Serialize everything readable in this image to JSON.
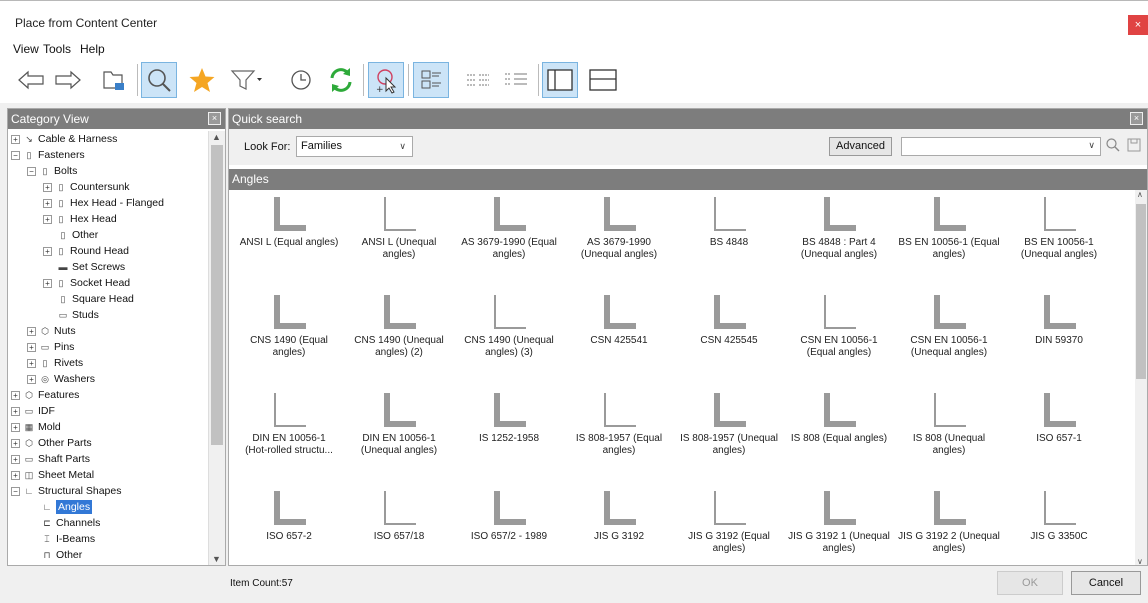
{
  "window": {
    "title": "Place from Content Center",
    "close_glyph": "×"
  },
  "menu": [
    "View",
    "Tools",
    "Help"
  ],
  "toolbar": [
    {
      "name": "back-arrow-icon",
      "selected": false
    },
    {
      "name": "forward-arrow-icon",
      "selected": false
    },
    {
      "name": "tree-view-icon",
      "selected": false
    },
    {
      "name": "search-icon",
      "selected": true
    },
    {
      "name": "favorites-star-icon",
      "selected": false
    },
    {
      "name": "filter-icon",
      "selected": false
    },
    {
      "name": "history-clock-icon",
      "selected": false
    },
    {
      "name": "refresh-icon",
      "selected": false
    },
    {
      "name": "autodrop-icon",
      "selected": true
    },
    {
      "name": "view-large-icons-icon",
      "selected": true
    },
    {
      "name": "view-list-icon",
      "selected": false
    },
    {
      "name": "view-details-icon",
      "selected": false
    },
    {
      "name": "layout-vertical-split-icon",
      "selected": true
    },
    {
      "name": "layout-horizontal-split-icon",
      "selected": false
    }
  ],
  "category_view": {
    "title": "Category View",
    "close_glyph": "×",
    "tree": [
      {
        "label": "Cable & Harness",
        "depth": 0,
        "expander": "+",
        "icon": "cable-icon"
      },
      {
        "label": "Fasteners",
        "depth": 0,
        "expander": "-",
        "icon": "fastener-icon"
      },
      {
        "label": "Bolts",
        "depth": 1,
        "expander": "-",
        "icon": "bolt-icon"
      },
      {
        "label": "Countersunk",
        "depth": 2,
        "expander": "+",
        "icon": "bolt-icon"
      },
      {
        "label": "Hex Head - Flanged",
        "depth": 2,
        "expander": "+",
        "icon": "bolt-icon"
      },
      {
        "label": "Hex Head",
        "depth": 2,
        "expander": "+",
        "icon": "bolt-icon"
      },
      {
        "label": "Other",
        "depth": 2,
        "expander": "",
        "icon": "bolt-icon"
      },
      {
        "label": "Round Head",
        "depth": 2,
        "expander": "+",
        "icon": "bolt-icon"
      },
      {
        "label": "Set Screws",
        "depth": 2,
        "expander": "",
        "icon": "screw-icon"
      },
      {
        "label": "Socket Head",
        "depth": 2,
        "expander": "+",
        "icon": "bolt-icon"
      },
      {
        "label": "Square Head",
        "depth": 2,
        "expander": "",
        "icon": "bolt-icon"
      },
      {
        "label": "Studs",
        "depth": 2,
        "expander": "",
        "icon": "stud-icon"
      },
      {
        "label": "Nuts",
        "depth": 1,
        "expander": "+",
        "icon": "nut-icon"
      },
      {
        "label": "Pins",
        "depth": 1,
        "expander": "+",
        "icon": "pin-icon"
      },
      {
        "label": "Rivets",
        "depth": 1,
        "expander": "+",
        "icon": "rivet-icon"
      },
      {
        "label": "Washers",
        "depth": 1,
        "expander": "+",
        "icon": "washer-icon"
      },
      {
        "label": "Features",
        "depth": 0,
        "expander": "+",
        "icon": "feature-icon"
      },
      {
        "label": "IDF",
        "depth": 0,
        "expander": "+",
        "icon": "idf-icon"
      },
      {
        "label": "Mold",
        "depth": 0,
        "expander": "+",
        "icon": "mold-icon"
      },
      {
        "label": "Other Parts",
        "depth": 0,
        "expander": "+",
        "icon": "part-icon"
      },
      {
        "label": "Shaft Parts",
        "depth": 0,
        "expander": "+",
        "icon": "shaft-icon"
      },
      {
        "label": "Sheet Metal",
        "depth": 0,
        "expander": "+",
        "icon": "sheet-metal-icon"
      },
      {
        "label": "Structural Shapes",
        "depth": 0,
        "expander": "-",
        "icon": "angle-icon"
      },
      {
        "label": "Angles",
        "depth": 1,
        "expander": "",
        "icon": "angle-icon",
        "selected": true
      },
      {
        "label": "Channels",
        "depth": 1,
        "expander": "",
        "icon": "channel-icon"
      },
      {
        "label": "I-Beams",
        "depth": 1,
        "expander": "",
        "icon": "ibeam-icon"
      },
      {
        "label": "Other",
        "depth": 1,
        "expander": "",
        "icon": "shape-icon"
      }
    ]
  },
  "quick_search": {
    "title": "Quick search",
    "close_glyph": "×",
    "look_for_label": "Look For:",
    "look_for_value": "Families",
    "advanced_label": "Advanced",
    "search_value": ""
  },
  "category_title": "Angles",
  "items": [
    {
      "l1": "ANSI L (Equal angles)",
      "l2": ""
    },
    {
      "l1": "ANSI L (Unequal",
      "l2": "angles)"
    },
    {
      "l1": "AS 3679-1990 (Equal",
      "l2": "angles)"
    },
    {
      "l1": "AS 3679-1990",
      "l2": "(Unequal angles)"
    },
    {
      "l1": "BS 4848",
      "l2": ""
    },
    {
      "l1": "BS 4848 : Part 4",
      "l2": "(Unequal angles)"
    },
    {
      "l1": "BS EN 10056-1 (Equal",
      "l2": "angles)"
    },
    {
      "l1": "BS EN 10056-1",
      "l2": "(Unequal angles)"
    },
    {
      "l1": "CNS 1490 (Equal",
      "l2": "angles)"
    },
    {
      "l1": "CNS 1490 (Unequal",
      "l2": "angles) (2)"
    },
    {
      "l1": "CNS 1490 (Unequal",
      "l2": "angles) (3)"
    },
    {
      "l1": "CSN 425541",
      "l2": ""
    },
    {
      "l1": "CSN 425545",
      "l2": ""
    },
    {
      "l1": "CSN EN 10056-1",
      "l2": "(Equal angles)"
    },
    {
      "l1": "CSN EN 10056-1",
      "l2": "(Unequal angles)"
    },
    {
      "l1": "DIN 59370",
      "l2": ""
    },
    {
      "l1": "DIN EN 10056-1",
      "l2": "(Hot-rolled structu..."
    },
    {
      "l1": "DIN EN 10056-1",
      "l2": "(Unequal angles)"
    },
    {
      "l1": "IS 1252-1958",
      "l2": ""
    },
    {
      "l1": "IS 808-1957 (Equal",
      "l2": "angles)"
    },
    {
      "l1": "IS 808-1957 (Unequal",
      "l2": "angles)"
    },
    {
      "l1": "IS 808 (Equal angles)",
      "l2": ""
    },
    {
      "l1": "IS 808 (Unequal",
      "l2": "angles)"
    },
    {
      "l1": "ISO 657-1",
      "l2": ""
    },
    {
      "l1": "ISO 657-2",
      "l2": ""
    },
    {
      "l1": "ISO 657/18",
      "l2": ""
    },
    {
      "l1": "ISO 657/2 - 1989",
      "l2": ""
    },
    {
      "l1": "JIS G 3192",
      "l2": ""
    },
    {
      "l1": "JIS G 3192 (Equal",
      "l2": "angles)"
    },
    {
      "l1": "JIS G 3192 1 (Unequal",
      "l2": "angles)"
    },
    {
      "l1": "JIS G 3192 2 (Unequal",
      "l2": "angles)"
    },
    {
      "l1": "JIS G 3350C",
      "l2": ""
    }
  ],
  "status": {
    "item_count": "Item Count:57"
  },
  "buttons": {
    "ok": "OK",
    "cancel": "Cancel"
  },
  "colors": {
    "accent": "#3278d6",
    "header_gray": "#7d7d7d",
    "close_red": "#e04343",
    "toolbar_selected": "#cce4f7",
    "refresh_green": "#2eaa3a",
    "star_orange": "#f5a623"
  }
}
